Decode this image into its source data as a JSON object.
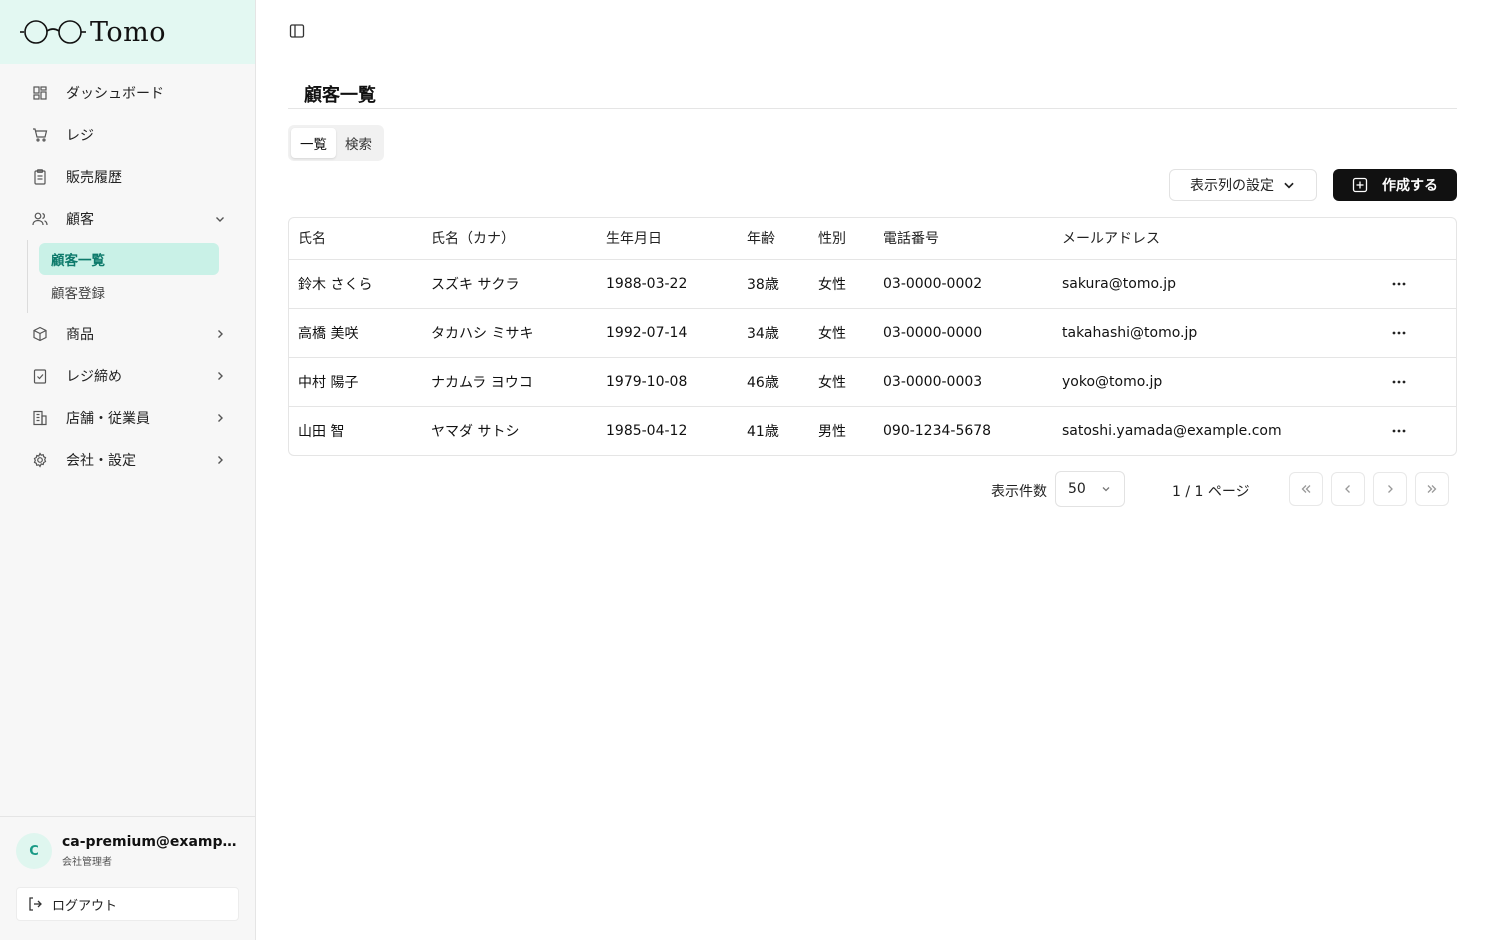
{
  "app": {
    "brand": "Tomo"
  },
  "sidebar": {
    "items": [
      {
        "label": "ダッシュボード",
        "icon": "dashboard-icon"
      },
      {
        "label": "レジ",
        "icon": "cart-icon"
      },
      {
        "label": "販売履歴",
        "icon": "receipt-icon"
      },
      {
        "label": "顧客",
        "icon": "users-icon",
        "expanded": true
      },
      {
        "label": "商品",
        "icon": "package-icon"
      },
      {
        "label": "レジ締め",
        "icon": "clipboard-check-icon"
      },
      {
        "label": "店舗・従業員",
        "icon": "building-icon"
      },
      {
        "label": "会社・設定",
        "icon": "gear-icon"
      }
    ],
    "sub_items": [
      {
        "label": "顧客一覧",
        "active": true
      },
      {
        "label": "顧客登録",
        "active": false
      }
    ],
    "user": {
      "initial": "C",
      "email": "ca-premium@example.com",
      "role": "会社管理者"
    },
    "logout_label": "ログアウト"
  },
  "main": {
    "title": "顧客一覧",
    "tabs": [
      {
        "label": "一覧",
        "active": true
      },
      {
        "label": "検索",
        "active": false
      }
    ],
    "column_settings_label": "表示列の設定",
    "create_label": "作成する",
    "table": {
      "headers": [
        "氏名",
        "氏名（カナ）",
        "生年月日",
        "年齢",
        "性別",
        "電話番号",
        "メールアドレス"
      ],
      "rows": [
        [
          "鈴木 さくら",
          "スズキ サクラ",
          "1988-03-22",
          "38歳",
          "女性",
          "03-0000-0002",
          "sakura@tomo.jp"
        ],
        [
          "高橋 美咲",
          "タカハシ ミサキ",
          "1992-07-14",
          "34歳",
          "女性",
          "03-0000-0000",
          "takahashi@tomo.jp"
        ],
        [
          "中村 陽子",
          "ナカムラ ヨウコ",
          "1979-10-08",
          "46歳",
          "女性",
          "03-0000-0003",
          "yoko@tomo.jp"
        ],
        [
          "山田 智",
          "ヤマダ サトシ",
          "1985-04-12",
          "41歳",
          "男性",
          "090-1234-5678",
          "satoshi.yamada@example.com"
        ]
      ],
      "row_action_icon": "more-horizontal-icon"
    },
    "pagination": {
      "per_page_label": "表示件数",
      "per_page_value": "50",
      "page_info": "1 / 1 ページ"
    }
  },
  "colors": {
    "brand_bg": "#e3f8f2",
    "active_sub_bg": "#c9f1e7",
    "active_sub_text": "#0d7a6b",
    "primary_button": "#111111"
  }
}
